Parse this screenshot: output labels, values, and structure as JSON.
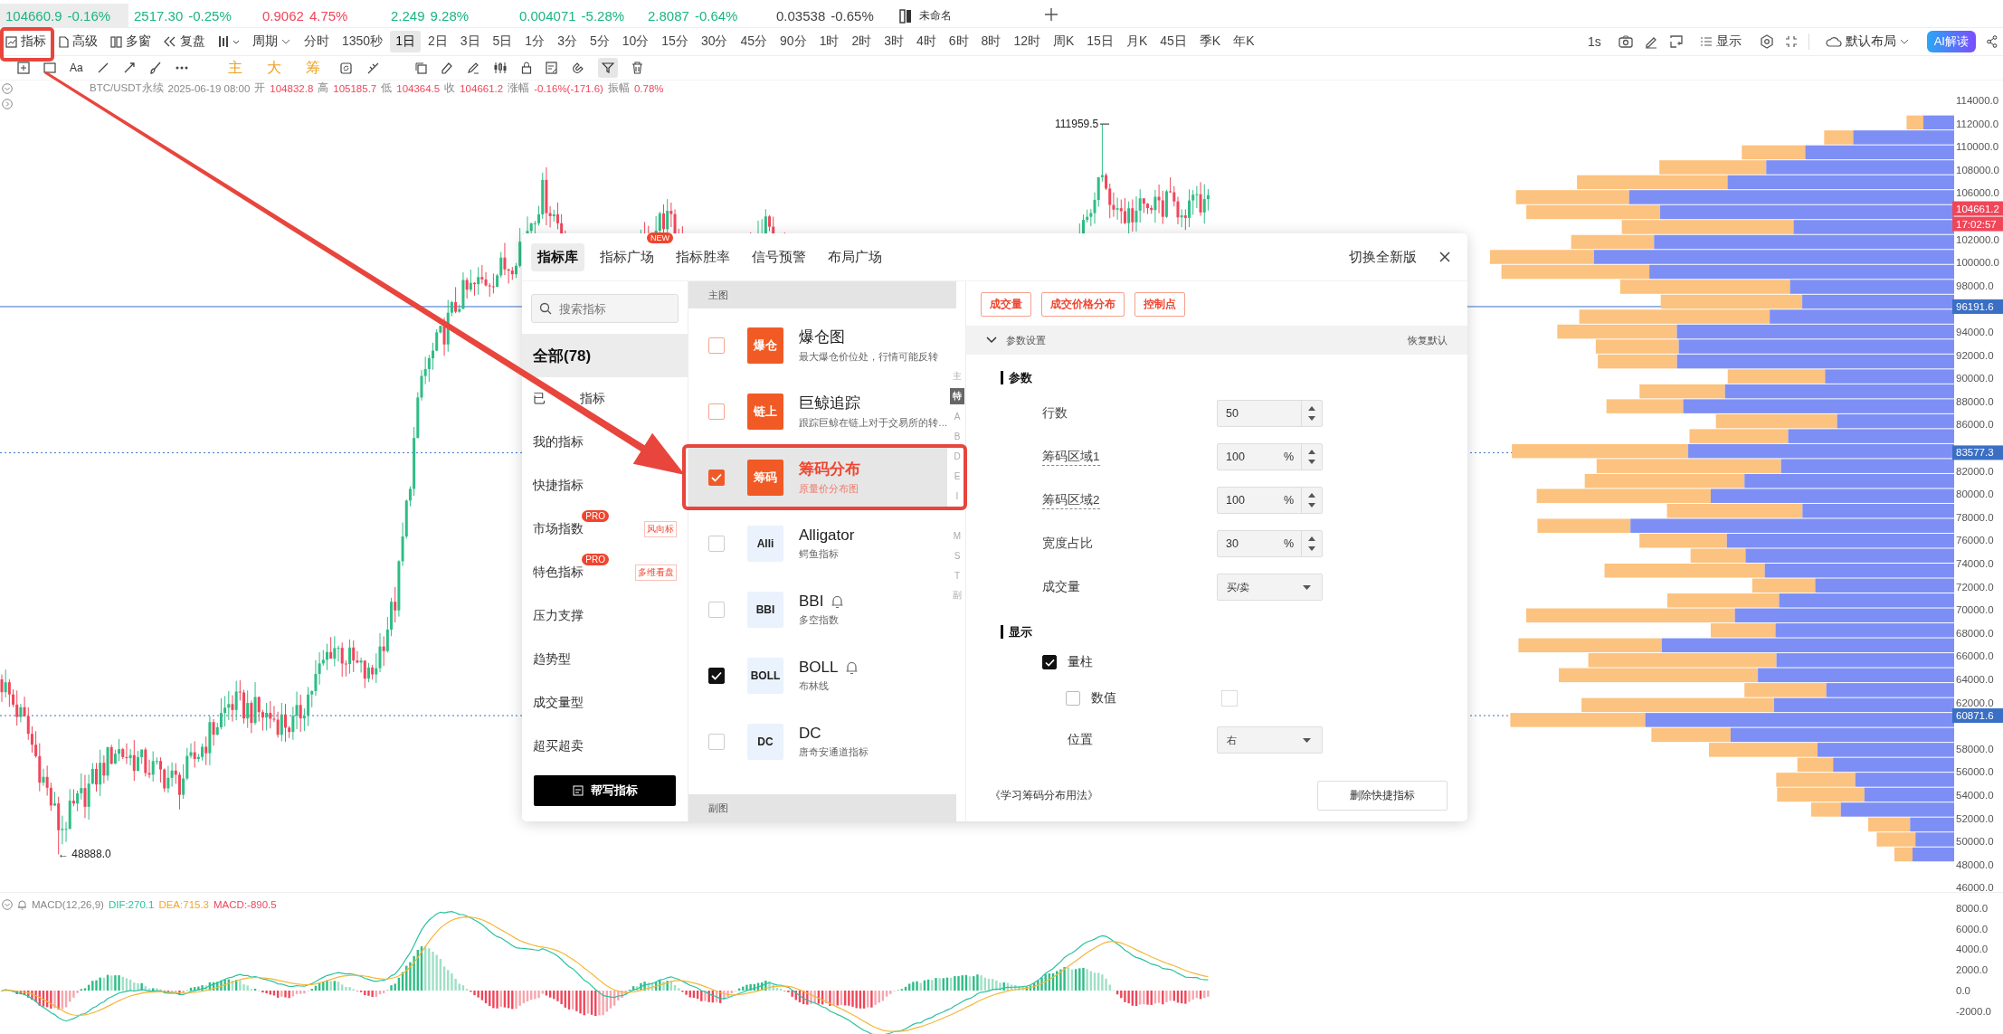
{
  "ticker": [
    {
      "price": "104660.9",
      "change": "-0.16%",
      "color": "#1bb583",
      "selected": true
    },
    {
      "price": "2517.30",
      "change": "-0.25%",
      "color": "#1bb583",
      "selected": false
    },
    {
      "price": "0.9062",
      "change": "4.75%",
      "color": "#f0465a",
      "selected": false
    },
    {
      "price": "2.249",
      "change": "9.28%",
      "color": "#1bb583",
      "selected": false
    },
    {
      "price": "0.004071",
      "change": "-5.28%",
      "color": "#1bb583",
      "selected": false
    },
    {
      "price": "2.8087",
      "change": "-0.64%",
      "color": "#1bb583",
      "selected": false
    },
    {
      "price": "0.03538",
      "change": "-0.65%",
      "color": "#444444",
      "selected": false
    }
  ],
  "workspace_tab": {
    "label": "未命名"
  },
  "toolbar": {
    "tools": [
      "指标",
      "高级",
      "多窗",
      "复盘"
    ],
    "period_menu": "周期",
    "periods": [
      {
        "label": "分时",
        "selected": false
      },
      {
        "label": "1350秒",
        "selected": false
      },
      {
        "label": "1日",
        "selected": true
      },
      {
        "label": "2日",
        "selected": false
      },
      {
        "label": "3日",
        "selected": false
      },
      {
        "label": "5日",
        "selected": false
      },
      {
        "label": "1分",
        "selected": false
      },
      {
        "label": "3分",
        "selected": false
      },
      {
        "label": "5分",
        "selected": false
      },
      {
        "label": "10分",
        "selected": false
      },
      {
        "label": "15分",
        "selected": false
      },
      {
        "label": "30分",
        "selected": false
      },
      {
        "label": "45分",
        "selected": false
      },
      {
        "label": "90分",
        "selected": false
      },
      {
        "label": "1时",
        "selected": false
      },
      {
        "label": "2时",
        "selected": false
      },
      {
        "label": "3时",
        "selected": false
      },
      {
        "label": "4时",
        "selected": false
      },
      {
        "label": "6时",
        "selected": false
      },
      {
        "label": "8时",
        "selected": false
      },
      {
        "label": "12时",
        "selected": false
      },
      {
        "label": "周K",
        "selected": false
      },
      {
        "label": "15日",
        "selected": false
      },
      {
        "label": "月K",
        "selected": false
      },
      {
        "label": "45日",
        "selected": false
      },
      {
        "label": "季K",
        "selected": false
      },
      {
        "label": "年K",
        "selected": false
      }
    ],
    "interval": "1s",
    "display": "显示",
    "layout": "默认布局",
    "ai": "AI解读"
  },
  "drawing_toolbar": {
    "text_tool": "Aa",
    "overlays": [
      "主",
      "大",
      "筹"
    ],
    "filter_active": true
  },
  "chart": {
    "info": {
      "symbol": "BTC/USDT永续",
      "time": "2025-06-19 08:00",
      "fields": [
        {
          "label": "开",
          "value": "104832.8"
        },
        {
          "label": "高",
          "value": "105185.7"
        },
        {
          "label": "低",
          "value": "104364.5"
        },
        {
          "label": "收",
          "value": "104661.2"
        },
        {
          "label": "涨幅",
          "value": "-0.16%(-171.6)"
        },
        {
          "label": "振幅",
          "value": "0.78%"
        }
      ]
    },
    "high_marker": "111959.5",
    "low_marker": "← 48888.0",
    "price_axis": [
      "114000.0",
      "112000.0",
      "110000.0",
      "108000.0",
      "106000.0",
      "102000.0",
      "100000.0",
      "98000.0",
      "94000.0",
      "92000.0",
      "90000.0",
      "88000.0",
      "86000.0",
      "82000.0",
      "80000.0",
      "78000.0",
      "76000.0",
      "74000.0",
      "72000.0",
      "70000.0",
      "68000.0",
      "66000.0",
      "64000.0",
      "62000.0",
      "58000.0",
      "56000.0",
      "54000.0",
      "52000.0",
      "50000.0",
      "48000.0",
      "46000.0"
    ],
    "price_tags": [
      {
        "text": "104661.2",
        "kind": "last"
      },
      {
        "text": "17:02:57",
        "kind": "countdown"
      },
      {
        "text": "96191.6",
        "kind": "level"
      },
      {
        "text": "83577.3",
        "kind": "level"
      },
      {
        "text": "60871.6",
        "kind": "level"
      }
    ]
  },
  "macd": {
    "title": "MACD(12,26,9)",
    "dif": "DIF:270.1",
    "dea": "DEA:715.3",
    "macd": "MACD:-890.5",
    "axis": [
      "8000.0",
      "6000.0",
      "4000.0",
      "2000.0",
      "0.0",
      "-2000.0"
    ]
  },
  "dialog": {
    "tabs": [
      {
        "label": "指标库",
        "selected": true
      },
      {
        "label": "指标广场",
        "selected": false,
        "badge": "NEW"
      },
      {
        "label": "指标胜率",
        "selected": false
      },
      {
        "label": "信号预警",
        "selected": false
      },
      {
        "label": "布局广场",
        "selected": false
      }
    ],
    "switch_version": "切换全新版",
    "search": {
      "placeholder": "搜索指标"
    },
    "categories": [
      {
        "label": "全部(78)",
        "selected": true
      },
      {
        "label": "已",
        "label_tail": "指标",
        "selected": false
      },
      {
        "label": "我的指标",
        "selected": false
      },
      {
        "label": "快捷指标",
        "selected": false
      },
      {
        "label": "市场指数",
        "selected": false,
        "badge": "PRO",
        "tag": "风向标"
      },
      {
        "label": "特色指标",
        "selected": false,
        "badge": "PRO",
        "tag": "多维看盘"
      },
      {
        "label": "压力支撑",
        "selected": false
      },
      {
        "label": "趋势型",
        "selected": false
      },
      {
        "label": "成交量型",
        "selected": false
      },
      {
        "label": "超买超卖",
        "selected": false
      }
    ],
    "write_button": "帮写指标",
    "main_section": "主图",
    "sub_section": "副图",
    "indicators": [
      {
        "name": "爆仓图",
        "description": "最大爆仓价位处，行情可能反转",
        "tile": "爆仓",
        "kind": "featured",
        "checked": false,
        "selected": false,
        "alert": false
      },
      {
        "name": "巨鲸追踪",
        "description": "跟踪巨鲸在链上对于交易所的转…",
        "tile": "链上",
        "kind": "featured",
        "checked": false,
        "selected": false,
        "alert": false
      },
      {
        "name": "筹码分布",
        "description": "原量价分布图",
        "tile": "筹码",
        "kind": "featured",
        "checked": true,
        "selected": true,
        "alert": false
      },
      {
        "name": "Alligator",
        "description": "鳄鱼指标",
        "tile": "Alli",
        "kind": "standard",
        "checked": false,
        "selected": false,
        "alert": false
      },
      {
        "name": "BBI",
        "description": "多空指数",
        "tile": "BBI",
        "kind": "standard",
        "checked": false,
        "selected": false,
        "alert": true
      },
      {
        "name": "BOLL",
        "description": "布林线",
        "tile": "BOLL",
        "kind": "standard",
        "checked": true,
        "selected": false,
        "alert": true
      },
      {
        "name": "DC",
        "description": "唐奇安通道指标",
        "tile": "DC",
        "kind": "standard",
        "checked": false,
        "selected": false,
        "alert": false
      }
    ],
    "index_letters": [
      {
        "label": "主",
        "selected": false
      },
      {
        "label": "特",
        "selected": true
      },
      {
        "label": "A",
        "selected": false
      },
      {
        "label": "B",
        "selected": false
      },
      {
        "label": "D",
        "selected": false
      },
      {
        "label": "E",
        "selected": false
      },
      {
        "label": "I",
        "selected": false
      },
      {
        "label": "M",
        "selected": false
      },
      {
        "label": "S",
        "selected": false
      },
      {
        "label": "T",
        "selected": false
      },
      {
        "label": "副",
        "selected": false
      }
    ],
    "settings": {
      "tags": [
        "成交量",
        "成交价格分布",
        "控制点"
      ],
      "header": "参数设置",
      "expanded": true,
      "reset": "恢复默认",
      "params_title": "参数",
      "params": [
        {
          "kind": "number",
          "label": "行数",
          "value": "50",
          "has_tooltip": false
        },
        {
          "kind": "number",
          "label": "筹码区域1",
          "value": "100",
          "unit": "%",
          "has_tooltip": true
        },
        {
          "kind": "number",
          "label": "筹码区域2",
          "value": "100",
          "unit": "%",
          "has_tooltip": true
        },
        {
          "kind": "number",
          "label": "宽度占比",
          "value": "30",
          "unit": "%",
          "has_tooltip": false
        },
        {
          "kind": "select",
          "label": "成交量",
          "value": "买/卖",
          "has_tooltip": false
        }
      ],
      "display_title": "显示",
      "display": [
        {
          "kind": "checkbox",
          "label": "量柱",
          "checked": true
        },
        {
          "kind": "checkbox_color",
          "label": "数值",
          "checked": false
        },
        {
          "kind": "select",
          "label": "位置",
          "value": "右"
        }
      ],
      "learn_link": "《学习筹码分布用法》",
      "delete_button": "删除快捷指标"
    }
  }
}
